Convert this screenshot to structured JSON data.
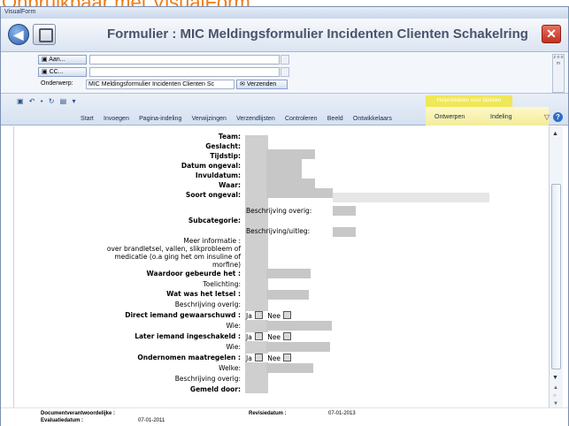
{
  "slide_title": "Onbruikbaar met VisualForm",
  "window_title": "VisualForm",
  "header": {
    "title": "Formulier :  MIC Meldingsformulier Incidenten Clienten Schakelring"
  },
  "mail": {
    "to_label": "Aan...",
    "cc_label": "CC...",
    "subject_label": "Onderwerp:",
    "subject_value": "MIC Meldingsformulier Incidenten Clienten Sc",
    "send_label": "Verzenden",
    "side_letters": "z o o m"
  },
  "ribbon": {
    "qat": "▣ ↶ • ↻ ▤ ▾",
    "tabs": [
      "Start",
      "Invoegen",
      "Pagina-indeling",
      "Verwijzingen",
      "Verzendlijsten",
      "Controleren",
      "Beeld",
      "Ontwikkelaars"
    ],
    "context_title": "Hulpmiddelen voor tabellen",
    "context_tabs": [
      "Ontwerpen",
      "Indeling"
    ]
  },
  "form": {
    "team": "Team:",
    "geslacht": "Geslacht:",
    "tijdstip": "Tijdstip:",
    "datum": "Datum ongeval:",
    "invuldatum": "Invuldatum:",
    "waar": "Waar:",
    "soort": "Soort ongeval:",
    "beschrijving_overig": "Beschrijving overig:",
    "subcategorie": "Subcategorie:",
    "beschrijving_uitleg": "Beschrijving/uitleg:",
    "meer_info_1": "Meer informatie :",
    "meer_info_2": "over brandletsel, vallen, slikprobleem of",
    "meer_info_3": "medicatie (o.a ging het om insuline of",
    "meer_info_4": "morfine)",
    "waardoor": "Waardoor gebeurde het :",
    "toelichting": "Toelichting:",
    "letsel": "Wat was het letsel :",
    "beschrijving_overig2": "Beschrijving overig:",
    "direct": "Direct iemand gewaarschuwd :",
    "wie1": "Wie:",
    "later": "Later iemand ingeschakeld :",
    "wie2": "Wie:",
    "maatregelen": "Ondernomen maatregelen :",
    "welke": "Welke:",
    "beschrijving_overig3": "Beschrijving overig:",
    "gemeld": "Gemeld door:",
    "ja": "Ja",
    "nee": "Nee"
  },
  "footer": {
    "docverantw_label": "Documentverantwoordelijke :",
    "evaluatie_label": "Evaluatiedatum :",
    "evaluatie_value": "07-01-2011",
    "revisie_label": "Revisiedatum :",
    "revisie_value": "07-01-2013"
  }
}
